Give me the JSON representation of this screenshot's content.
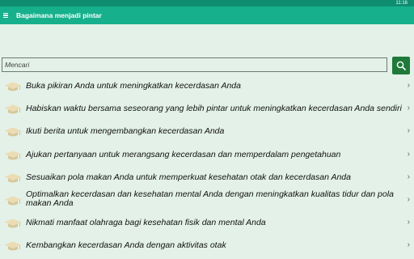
{
  "status_bar": {
    "time": "11:16"
  },
  "app_bar": {
    "title": "Bagaimana menjadi pintar"
  },
  "search": {
    "placeholder": "Mencari",
    "value": ""
  },
  "items": [
    {
      "label": "Buka pikiran Anda untuk meningkatkan kecerdasan Anda",
      "icon": "graduation-cap-icon"
    },
    {
      "label": "Habiskan waktu bersama seseorang yang lebih pintar untuk meningkatkan kecerdasan Anda sendiri",
      "icon": "graduation-cap-icon"
    },
    {
      "label": "Ikuti berita untuk mengembangkan kecerdasan Anda",
      "icon": "graduation-cap-icon"
    },
    {
      "label": "Ajukan pertanyaan untuk merangsang kecerdasan dan memperdalam pengetahuan",
      "icon": "graduation-cap-icon"
    },
    {
      "label": "Sesuaikan pola makan Anda untuk memperkuat kesehatan otak dan kecerdasan Anda",
      "icon": "graduation-cap-icon"
    },
    {
      "label": "Optimalkan kecerdasan dan kesehatan mental Anda dengan meningkatkan kualitas tidur dan pola makan Anda",
      "icon": "graduation-cap-icon"
    },
    {
      "label": "Nikmati manfaat olahraga bagi kesehatan fisik dan mental Anda",
      "icon": "graduation-cap-icon"
    },
    {
      "label": "Kembangkan kecerdasan Anda dengan aktivitas otak",
      "icon": "graduation-cap-icon"
    }
  ],
  "colors": {
    "background": "#e3f1e8",
    "app_bar": "#17b08d",
    "status_bar": "#0e8d70",
    "search_button": "#1f7a3a"
  }
}
